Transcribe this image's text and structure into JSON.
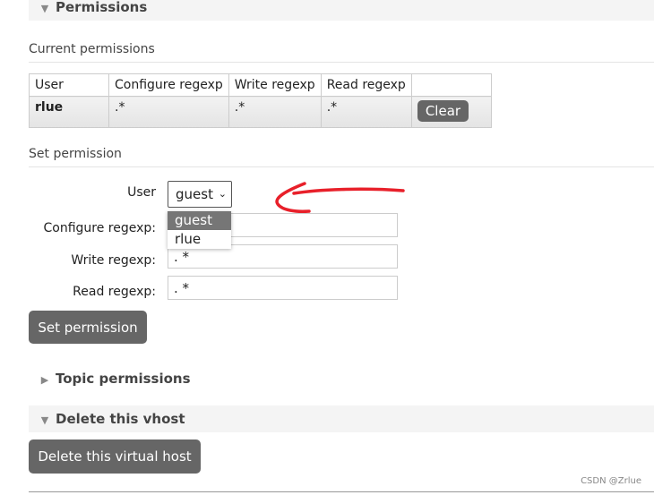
{
  "permissions": {
    "title": "Permissions",
    "current_title": "Current permissions",
    "headers": [
      "User",
      "Configure regexp",
      "Write regexp",
      "Read regexp"
    ],
    "rows": [
      {
        "user": "rlue",
        "configure": ".*",
        "write": ".*",
        "read": ".*",
        "action": "Clear"
      }
    ]
  },
  "set_permission": {
    "title": "Set permission",
    "user_label": "User",
    "user_value": "guest",
    "options": [
      "guest",
      "rlue"
    ],
    "configure_label": "Configure regexp:",
    "write_label": "Write regexp:",
    "read_label": "Read regexp:",
    "configure_value": "",
    "write_value": ". *",
    "read_value": ". *",
    "submit": "Set permission"
  },
  "topic": {
    "title": "Topic permissions"
  },
  "delete": {
    "title": "Delete this vhost",
    "button": "Delete this virtual host"
  },
  "watermark": "CSDN @Zrlue",
  "annotation_color": "#e8202a"
}
